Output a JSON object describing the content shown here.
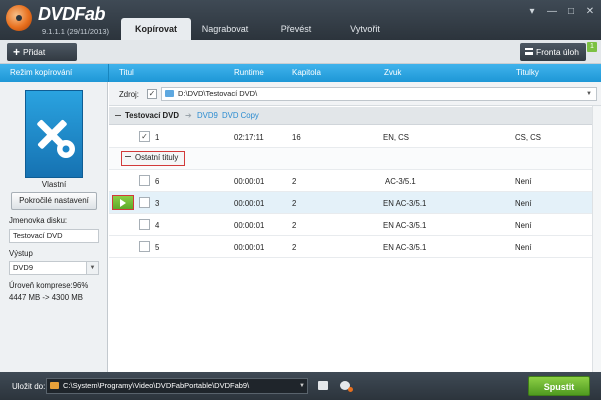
{
  "app": {
    "name": "DVDFab",
    "version": "9.1.1.1 (29/11/2013)"
  },
  "tabs": [
    {
      "label": "Kopírovat",
      "active": true
    },
    {
      "label": "Nagrabovat",
      "active": false
    },
    {
      "label": "Převést",
      "active": false
    },
    {
      "label": "Vytvořit",
      "active": false
    }
  ],
  "window_controls": {
    "menu": "▾",
    "minimize": "—",
    "maximize": "□",
    "close": "✕"
  },
  "toolbar": {
    "add_label": "Přidat",
    "queue_label": "Fronta úloh",
    "queue_badge": "1"
  },
  "columns": {
    "mode": "Režim kopírování",
    "title": "Titul",
    "runtime": "Runtime",
    "chapter": "Kapitola",
    "audio": "Zvuk",
    "subtitles": "Titulky"
  },
  "left_panel": {
    "mode_name": "Vlastní",
    "advanced_button": "Pokročilé nastavení",
    "volume_label_caption": "Jmenovka disku:",
    "volume_label_value": "Testovací DVD",
    "output_caption": "Výstup",
    "output_value": "DVD9",
    "compression": "Úroveň komprese:96%",
    "size_info": "4447 MB -> 4300 MB"
  },
  "source": {
    "label": "Zdroj:",
    "path": "D:\\DVD\\Testovací DVD\\"
  },
  "disc": {
    "name": "Testovací DVD",
    "format": "DVD9",
    "profile": "DVD Copy"
  },
  "other_titles_label": "Ostatní tituly",
  "titles": [
    {
      "num": "1",
      "runtime": "02:17:11",
      "chapters": "16",
      "audio": "EN, CS",
      "subs": "CS, CS",
      "checked": true
    },
    {
      "num": "6",
      "runtime": "00:00:01",
      "chapters": "2",
      "audio": "AC-3/5.1",
      "subs": "Není",
      "checked": false
    },
    {
      "num": "3",
      "runtime": "00:00:01",
      "chapters": "2",
      "audio": "EN AC-3/5.1",
      "subs": "Není",
      "checked": false
    },
    {
      "num": "4",
      "runtime": "00:00:01",
      "chapters": "2",
      "audio": "EN AC-3/5.1",
      "subs": "Není",
      "checked": false
    },
    {
      "num": "5",
      "runtime": "00:00:01",
      "chapters": "2",
      "audio": "EN AC-3/5.1",
      "subs": "Není",
      "checked": false
    }
  ],
  "bottom": {
    "save_to_label": "Uložit do:",
    "save_path": "C:\\System\\Programy\\Video\\DVDFabPortable\\DVDFab9\\",
    "start_label": "Spustit"
  },
  "colors": {
    "accent_blue": "#1e97d6",
    "start_green": "#6bb830",
    "highlight_red": "#d23a3a",
    "header_dark": "#2c343c"
  },
  "icons": [
    "dvdfab-logo-icon",
    "plus-icon",
    "queue-icon",
    "copy-mode-icon",
    "folder-icon",
    "checkbox-icon",
    "play-icon",
    "disc-icon",
    "dropdown-arrow-icon"
  ]
}
